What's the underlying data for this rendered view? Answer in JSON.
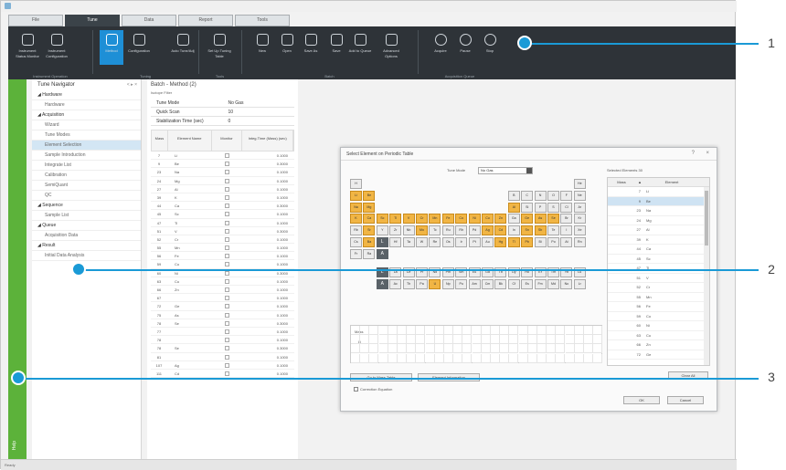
{
  "tabs": [
    "File",
    "Tune",
    "Data",
    "Report",
    "Tools"
  ],
  "active_tab": 1,
  "ribbon": {
    "groups": [
      "Instrument Operation",
      "Tuning",
      "Tools",
      "Batch",
      "Acquisition Queue"
    ],
    "buttons": [
      "Instrument Status Monitor",
      "Instrument Configuration",
      "Method",
      "Configuration",
      "Auto Tune/Adj",
      "Set Up Tuning Table",
      "New",
      "Open",
      "Save As",
      "Save",
      "Add to Queue",
      "Advanced Options",
      "Acquire",
      "Pause",
      "Stop"
    ]
  },
  "nav": {
    "title": "Tune Navigator",
    "controls": "< ▸ ×",
    "items": [
      {
        "label": "Hardware",
        "group": true
      },
      {
        "label": "Hardware",
        "group": false
      },
      {
        "label": "Acquisition",
        "group": true
      },
      {
        "label": "Wizard",
        "group": false
      },
      {
        "label": "Tune Modes",
        "group": false
      },
      {
        "label": "Element Selection",
        "group": false,
        "selected": true
      },
      {
        "label": "Sample Introduction",
        "group": false
      },
      {
        "label": "Integrate List",
        "group": false
      },
      {
        "label": "Calibration",
        "group": false
      },
      {
        "label": "SemiQuant",
        "group": false
      },
      {
        "label": "QC",
        "group": false
      },
      {
        "label": "Sequence",
        "group": true
      },
      {
        "label": "Sample List",
        "group": false
      },
      {
        "label": "Queue",
        "group": true
      },
      {
        "label": "Acquisition Data",
        "group": false
      },
      {
        "label": "Result",
        "group": true
      },
      {
        "label": "Initial Data Analysis",
        "group": false
      }
    ]
  },
  "sidebar_label": "Help",
  "method": {
    "title": "Batch - Method (2)",
    "subtitle": "Isotope Filter",
    "props": [
      {
        "name": "Tune Mode",
        "value": "No Gas"
      },
      {
        "name": "Quick Scan",
        "value": "10"
      },
      {
        "name": "Stabilization Time (sec)",
        "value": "0"
      }
    ],
    "columns": [
      "Mass",
      "Element Name",
      "Monitor",
      "Integ.Time (Mass) (sec)"
    ],
    "rows": [
      [
        "7",
        "Li",
        "0.1000"
      ],
      [
        "9",
        "Be",
        "0.3000"
      ],
      [
        "23",
        "Na",
        "0.1000"
      ],
      [
        "24",
        "Mg",
        "0.1000"
      ],
      [
        "27",
        "Al",
        "0.1000"
      ],
      [
        "39",
        "K",
        "0.1000"
      ],
      [
        "44",
        "Ca",
        "0.3000"
      ],
      [
        "45",
        "Sc",
        "0.1000"
      ],
      [
        "47",
        "Ti",
        "0.1000"
      ],
      [
        "51",
        "V",
        "0.3000"
      ],
      [
        "52",
        "Cr",
        "0.1000"
      ],
      [
        "55",
        "Mn",
        "0.1000"
      ],
      [
        "56",
        "Fe",
        "0.1000"
      ],
      [
        "59",
        "Co",
        "0.1000"
      ],
      [
        "60",
        "Ni",
        "0.3000"
      ],
      [
        "63",
        "Cu",
        "0.1000"
      ],
      [
        "66",
        "Zn",
        "0.1000"
      ],
      [
        "67",
        "",
        "0.1000"
      ],
      [
        "72",
        "Ge",
        "0.1000"
      ],
      [
        "75",
        "As",
        "0.1000"
      ],
      [
        "78",
        "Se",
        "0.3000"
      ],
      [
        "77",
        "",
        "0.1000"
      ],
      [
        "78",
        "",
        "0.1000"
      ],
      [
        "78",
        "Se",
        "0.3000"
      ],
      [
        "81",
        "",
        "0.1000"
      ],
      [
        "107",
        "Ag",
        "0.1000"
      ],
      [
        "111",
        "Cd",
        "0.1000"
      ]
    ]
  },
  "dialog": {
    "title": "Select Element on Periodic Table",
    "tune_mode_label": "Tune Mode",
    "tune_mode_value": "No Gas",
    "selected_label": "Selected Elements",
    "selected_count": "30",
    "sel_columns": [
      "Mass",
      "▲",
      "Element"
    ],
    "selected": [
      [
        "7",
        "Li"
      ],
      [
        "9",
        "Be"
      ],
      [
        "23",
        "Na"
      ],
      [
        "24",
        "Mg"
      ],
      [
        "27",
        "Al"
      ],
      [
        "39",
        "K"
      ],
      [
        "44",
        "Ca"
      ],
      [
        "45",
        "Sc"
      ],
      [
        "47",
        "Ti"
      ],
      [
        "51",
        "V"
      ],
      [
        "52",
        "Cr"
      ],
      [
        "55",
        "Mn"
      ],
      [
        "56",
        "Fe"
      ],
      [
        "59",
        "Co"
      ],
      [
        "60",
        "Ni"
      ],
      [
        "63",
        "Cu"
      ],
      [
        "66",
        "Zn"
      ],
      [
        "72",
        "Ge"
      ]
    ],
    "mass_label": "Mass",
    "mass_row": "Li",
    "btn_periodic": "Go to Mass Table",
    "btn_info": "Element Information",
    "btn_clear": "Clear All",
    "btn_ok": "OK",
    "btn_cancel": "Cancel",
    "checkbox_label": "Correction Equation",
    "elements": [
      {
        "s": "H",
        "r": 0,
        "c": 0,
        "on": false
      },
      {
        "s": "He",
        "r": 0,
        "c": 17,
        "on": false
      },
      {
        "s": "Li",
        "r": 1,
        "c": 0,
        "on": true
      },
      {
        "s": "Be",
        "r": 1,
        "c": 1,
        "on": true
      },
      {
        "s": "B",
        "r": 1,
        "c": 12,
        "on": false
      },
      {
        "s": "C",
        "r": 1,
        "c": 13,
        "on": false
      },
      {
        "s": "N",
        "r": 1,
        "c": 14,
        "on": false
      },
      {
        "s": "O",
        "r": 1,
        "c": 15,
        "on": false
      },
      {
        "s": "F",
        "r": 1,
        "c": 16,
        "on": false
      },
      {
        "s": "Ne",
        "r": 1,
        "c": 17,
        "on": false
      },
      {
        "s": "Na",
        "r": 2,
        "c": 0,
        "on": true
      },
      {
        "s": "Mg",
        "r": 2,
        "c": 1,
        "on": true
      },
      {
        "s": "Al",
        "r": 2,
        "c": 12,
        "on": true
      },
      {
        "s": "Si",
        "r": 2,
        "c": 13,
        "on": false
      },
      {
        "s": "P",
        "r": 2,
        "c": 14,
        "on": false
      },
      {
        "s": "S",
        "r": 2,
        "c": 15,
        "on": false
      },
      {
        "s": "Cl",
        "r": 2,
        "c": 16,
        "on": false
      },
      {
        "s": "Ar",
        "r": 2,
        "c": 17,
        "on": false
      },
      {
        "s": "K",
        "r": 3,
        "c": 0,
        "on": true
      },
      {
        "s": "Ca",
        "r": 3,
        "c": 1,
        "on": true
      },
      {
        "s": "Sc",
        "r": 3,
        "c": 2,
        "on": true
      },
      {
        "s": "Ti",
        "r": 3,
        "c": 3,
        "on": true
      },
      {
        "s": "V",
        "r": 3,
        "c": 4,
        "on": true
      },
      {
        "s": "Cr",
        "r": 3,
        "c": 5,
        "on": true
      },
      {
        "s": "Mn",
        "r": 3,
        "c": 6,
        "on": true
      },
      {
        "s": "Fe",
        "r": 3,
        "c": 7,
        "on": true
      },
      {
        "s": "Co",
        "r": 3,
        "c": 8,
        "on": true
      },
      {
        "s": "Ni",
        "r": 3,
        "c": 9,
        "on": true
      },
      {
        "s": "Cu",
        "r": 3,
        "c": 10,
        "on": true
      },
      {
        "s": "Zn",
        "r": 3,
        "c": 11,
        "on": true
      },
      {
        "s": "Ga",
        "r": 3,
        "c": 12,
        "on": false
      },
      {
        "s": "Ge",
        "r": 3,
        "c": 13,
        "on": true
      },
      {
        "s": "As",
        "r": 3,
        "c": 14,
        "on": true
      },
      {
        "s": "Se",
        "r": 3,
        "c": 15,
        "on": true
      },
      {
        "s": "Br",
        "r": 3,
        "c": 16,
        "on": false
      },
      {
        "s": "Kr",
        "r": 3,
        "c": 17,
        "on": false
      },
      {
        "s": "Rb",
        "r": 4,
        "c": 0,
        "on": false
      },
      {
        "s": "Sr",
        "r": 4,
        "c": 1,
        "on": true
      },
      {
        "s": "Y",
        "r": 4,
        "c": 2,
        "on": false
      },
      {
        "s": "Zr",
        "r": 4,
        "c": 3,
        "on": false
      },
      {
        "s": "Nb",
        "r": 4,
        "c": 4,
        "on": false
      },
      {
        "s": "Mo",
        "r": 4,
        "c": 5,
        "on": true
      },
      {
        "s": "Tc",
        "r": 4,
        "c": 6,
        "on": false
      },
      {
        "s": "Ru",
        "r": 4,
        "c": 7,
        "on": false
      },
      {
        "s": "Rh",
        "r": 4,
        "c": 8,
        "on": false
      },
      {
        "s": "Pd",
        "r": 4,
        "c": 9,
        "on": false
      },
      {
        "s": "Ag",
        "r": 4,
        "c": 10,
        "on": true
      },
      {
        "s": "Cd",
        "r": 4,
        "c": 11,
        "on": true
      },
      {
        "s": "In",
        "r": 4,
        "c": 12,
        "on": false
      },
      {
        "s": "Sn",
        "r": 4,
        "c": 13,
        "on": true
      },
      {
        "s": "Sb",
        "r": 4,
        "c": 14,
        "on": true
      },
      {
        "s": "Te",
        "r": 4,
        "c": 15,
        "on": false
      },
      {
        "s": "I",
        "r": 4,
        "c": 16,
        "on": false
      },
      {
        "s": "Xe",
        "r": 4,
        "c": 17,
        "on": false
      },
      {
        "s": "Cs",
        "r": 5,
        "c": 0,
        "on": false
      },
      {
        "s": "Ba",
        "r": 5,
        "c": 1,
        "on": true
      },
      {
        "s": "L",
        "r": 5,
        "c": 2,
        "on": false,
        "lbl": true
      },
      {
        "s": "Hf",
        "r": 5,
        "c": 3,
        "on": false
      },
      {
        "s": "Ta",
        "r": 5,
        "c": 4,
        "on": false
      },
      {
        "s": "W",
        "r": 5,
        "c": 5,
        "on": false
      },
      {
        "s": "Re",
        "r": 5,
        "c": 6,
        "on": false
      },
      {
        "s": "Os",
        "r": 5,
        "c": 7,
        "on": false
      },
      {
        "s": "Ir",
        "r": 5,
        "c": 8,
        "on": false
      },
      {
        "s": "Pt",
        "r": 5,
        "c": 9,
        "on": false
      },
      {
        "s": "Au",
        "r": 5,
        "c": 10,
        "on": false
      },
      {
        "s": "Hg",
        "r": 5,
        "c": 11,
        "on": true
      },
      {
        "s": "Tl",
        "r": 5,
        "c": 12,
        "on": true
      },
      {
        "s": "Pb",
        "r": 5,
        "c": 13,
        "on": true
      },
      {
        "s": "Bi",
        "r": 5,
        "c": 14,
        "on": false
      },
      {
        "s": "Po",
        "r": 5,
        "c": 15,
        "on": false
      },
      {
        "s": "At",
        "r": 5,
        "c": 16,
        "on": false
      },
      {
        "s": "Rn",
        "r": 5,
        "c": 17,
        "on": false
      },
      {
        "s": "Fr",
        "r": 6,
        "c": 0,
        "on": false
      },
      {
        "s": "Ra",
        "r": 6,
        "c": 1,
        "on": false
      },
      {
        "s": "A",
        "r": 6,
        "c": 2,
        "on": false,
        "lbl": true
      },
      {
        "s": "L",
        "r": 7.6,
        "c": 2,
        "on": false,
        "lbl": true
      },
      {
        "s": "La",
        "r": 7.6,
        "c": 3,
        "on": false
      },
      {
        "s": "Ce",
        "r": 7.6,
        "c": 4,
        "on": false
      },
      {
        "s": "Pr",
        "r": 7.6,
        "c": 5,
        "on": false
      },
      {
        "s": "Nd",
        "r": 7.6,
        "c": 6,
        "on": false
      },
      {
        "s": "Pm",
        "r": 7.6,
        "c": 7,
        "on": false
      },
      {
        "s": "Sm",
        "r": 7.6,
        "c": 8,
        "on": false
      },
      {
        "s": "Eu",
        "r": 7.6,
        "c": 9,
        "on": false
      },
      {
        "s": "Gd",
        "r": 7.6,
        "c": 10,
        "on": false
      },
      {
        "s": "Tb",
        "r": 7.6,
        "c": 11,
        "on": false
      },
      {
        "s": "Dy",
        "r": 7.6,
        "c": 12,
        "on": false
      },
      {
        "s": "Ho",
        "r": 7.6,
        "c": 13,
        "on": false
      },
      {
        "s": "Er",
        "r": 7.6,
        "c": 14,
        "on": false
      },
      {
        "s": "Tm",
        "r": 7.6,
        "c": 15,
        "on": false
      },
      {
        "s": "Yb",
        "r": 7.6,
        "c": 16,
        "on": false
      },
      {
        "s": "Lu",
        "r": 7.6,
        "c": 17,
        "on": false
      },
      {
        "s": "A",
        "r": 8.6,
        "c": 2,
        "on": false,
        "lbl": true
      },
      {
        "s": "Ac",
        "r": 8.6,
        "c": 3,
        "on": false
      },
      {
        "s": "Th",
        "r": 8.6,
        "c": 4,
        "on": false
      },
      {
        "s": "Pa",
        "r": 8.6,
        "c": 5,
        "on": false
      },
      {
        "s": "U",
        "r": 8.6,
        "c": 6,
        "on": true
      },
      {
        "s": "Np",
        "r": 8.6,
        "c": 7,
        "on": false
      },
      {
        "s": "Pu",
        "r": 8.6,
        "c": 8,
        "on": false
      },
      {
        "s": "Am",
        "r": 8.6,
        "c": 9,
        "on": false
      },
      {
        "s": "Cm",
        "r": 8.6,
        "c": 10,
        "on": false
      },
      {
        "s": "Bk",
        "r": 8.6,
        "c": 11,
        "on": false
      },
      {
        "s": "Cf",
        "r": 8.6,
        "c": 12,
        "on": false
      },
      {
        "s": "Es",
        "r": 8.6,
        "c": 13,
        "on": false
      },
      {
        "s": "Fm",
        "r": 8.6,
        "c": 14,
        "on": false
      },
      {
        "s": "Md",
        "r": 8.6,
        "c": 15,
        "on": false
      },
      {
        "s": "No",
        "r": 8.6,
        "c": 16,
        "on": false
      },
      {
        "s": "Lr",
        "r": 8.6,
        "c": 17,
        "on": false
      }
    ]
  },
  "callouts": [
    "1",
    "2",
    "3"
  ],
  "status_text": "Ready",
  "colors": {
    "accent": "#1a9ad6",
    "green": "#5cb23a",
    "selected_element": "#f1b544",
    "ribbon": "#2e3338"
  }
}
